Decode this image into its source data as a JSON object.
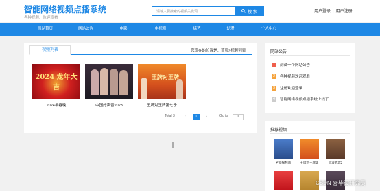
{
  "header": {
    "title": "智能网络视频点播系统",
    "subtitle": "各种视频、欢迎观看",
    "search_placeholder": "请输入要搜索的视频关键词",
    "search_button": "搜 索",
    "login": "用户登录",
    "separator": "|",
    "register": "用户注册"
  },
  "nav": {
    "items": [
      {
        "label": "网站首页"
      },
      {
        "label": "网站公告"
      },
      {
        "label": "电影"
      },
      {
        "label": "电视剧"
      },
      {
        "label": "综艺"
      },
      {
        "label": "动漫"
      },
      {
        "label": "个人中心"
      }
    ]
  },
  "main": {
    "tab": "视频列表",
    "breadcrumb": "您现在的位置是：首页>视频列表",
    "videos": [
      {
        "title": "2024年春晚",
        "thumb_text": "2024 龙年大吉",
        "color": "#c0131b"
      },
      {
        "title": "中国好声音2023",
        "thumb_text": "",
        "color": "#2a1f2a"
      },
      {
        "title": "王牌对王牌第七季",
        "thumb_text": "王牌对王牌",
        "color": "#d4501d"
      }
    ],
    "pager": {
      "total": "Total 3",
      "prev": "‹",
      "current": "1",
      "next": "›",
      "goto_label": "Go to",
      "goto_value": "1"
    }
  },
  "sidebar": {
    "announce_title": "网站公告",
    "announcements": [
      {
        "num": "1",
        "text": "测试一个网站公告",
        "color": "#ef5f4c"
      },
      {
        "num": "2",
        "text": "各种视频欢迎观看",
        "color": "#f5a23b"
      },
      {
        "num": "3",
        "text": "注册欢迎登录",
        "color": "#f5a23b"
      },
      {
        "num": "4",
        "text": "智能网络视频点播系统上线了",
        "color": "#cccccc"
      }
    ],
    "recommend_title": "推荐视频",
    "recommends": [
      {
        "label": "名侦探柯南",
        "color": "#2b4e8c"
      },
      {
        "label": "王牌对王牌第",
        "color": "#d4501d"
      },
      {
        "label": "流浪地球2",
        "color": "#5a3a2a"
      },
      {
        "label": "",
        "color": "#c0131b"
      },
      {
        "label": "",
        "color": "#b5842e"
      },
      {
        "label": "",
        "color": "#3a2c3a"
      }
    ]
  },
  "watermark": "CSDN @毕设研究员"
}
